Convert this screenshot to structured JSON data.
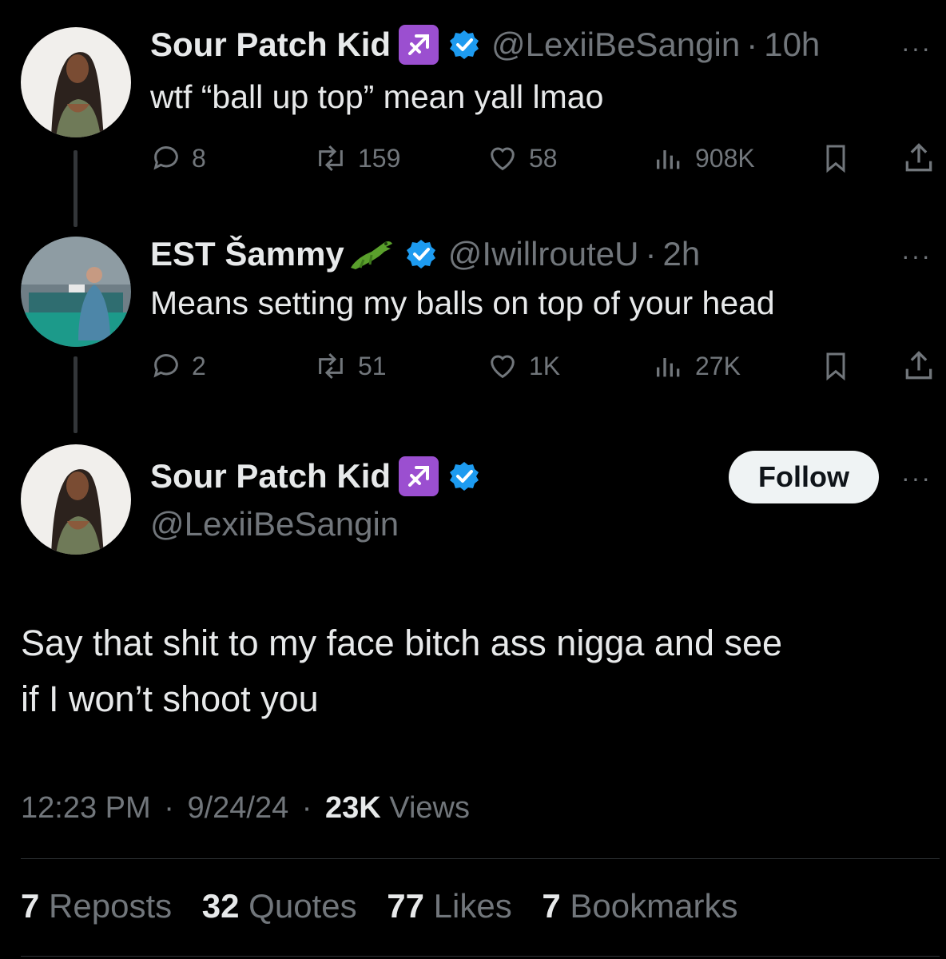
{
  "tweet1": {
    "name": "Sour Patch Kid",
    "name_emoji": "♐",
    "handle": "@LexiiBeSangin",
    "sep": "·",
    "time": "10h",
    "more": "···",
    "text": "wtf “ball up top” mean yall lmao",
    "replies": "8",
    "reposts": "159",
    "likes": "58",
    "views": "908K"
  },
  "tweet2": {
    "name": "EST Šammy",
    "name_emoji": "alligator-emoji",
    "handle": "@IwillrouteU",
    "sep": "·",
    "time": "2h",
    "more": "···",
    "text": "Means setting my balls on top of your head",
    "replies": "2",
    "reposts": "51",
    "likes": "1K",
    "views": "27K"
  },
  "main_tweet": {
    "name": "Sour Patch Kid",
    "name_emoji": "♐",
    "handle": "@LexiiBeSangin",
    "follow_label": "Follow",
    "more": "···",
    "text_line1": "Say that shit to my face bitch ass nigga and see",
    "text_line2": "if I won’t shoot you",
    "time": "12:23 PM",
    "sep1": "·",
    "date": "9/24/24",
    "sep2": "·",
    "views_count": "23K",
    "views_label": "Views",
    "stats": {
      "reposts_count": "7",
      "reposts_label": "Reposts",
      "quotes_count": "32",
      "quotes_label": "Quotes",
      "likes_count": "77",
      "likes_label": "Likes",
      "bookmarks_count": "7",
      "bookmarks_label": "Bookmarks"
    }
  },
  "colors": {
    "background": "#000000",
    "text_primary": "#e7e9ea",
    "text_secondary": "#71767b",
    "verified_blue": "#1d9bf0",
    "sagittarius_purple": "#9b4fd0",
    "follow_button_bg": "#eff3f4"
  }
}
